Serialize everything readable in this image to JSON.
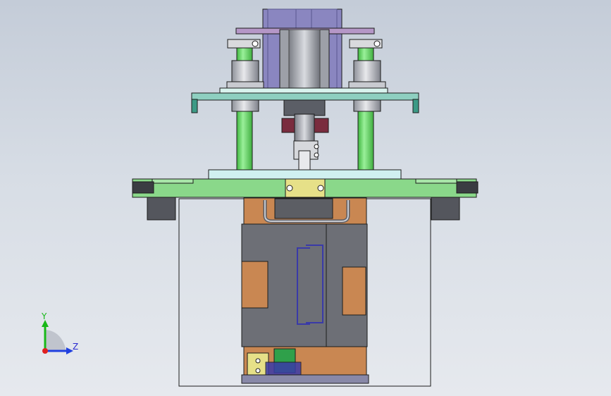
{
  "viewport": {
    "background_top": "#c4ccd8",
    "background_bottom": "#e6e9ee"
  },
  "colors": {
    "motor_purple": "#8a86c0",
    "plate_purple": "#b597c7",
    "plate_teal": "#8ecfc0",
    "plate_green": "#8ad88a",
    "rod_green": "#63d463",
    "housing_orange": "#c98752",
    "panel_gray": "#6d6f76",
    "wire_blue": "#3a3aa8",
    "clamp_yellow": "#e6e088",
    "terminal_green": "#2fa04a",
    "outline": "#1c1c1c"
  },
  "triad": {
    "y_label": "Y",
    "z_label": "Z",
    "y_color": "#18b818",
    "z_color": "#2040e0",
    "origin_color": "#e02020"
  }
}
